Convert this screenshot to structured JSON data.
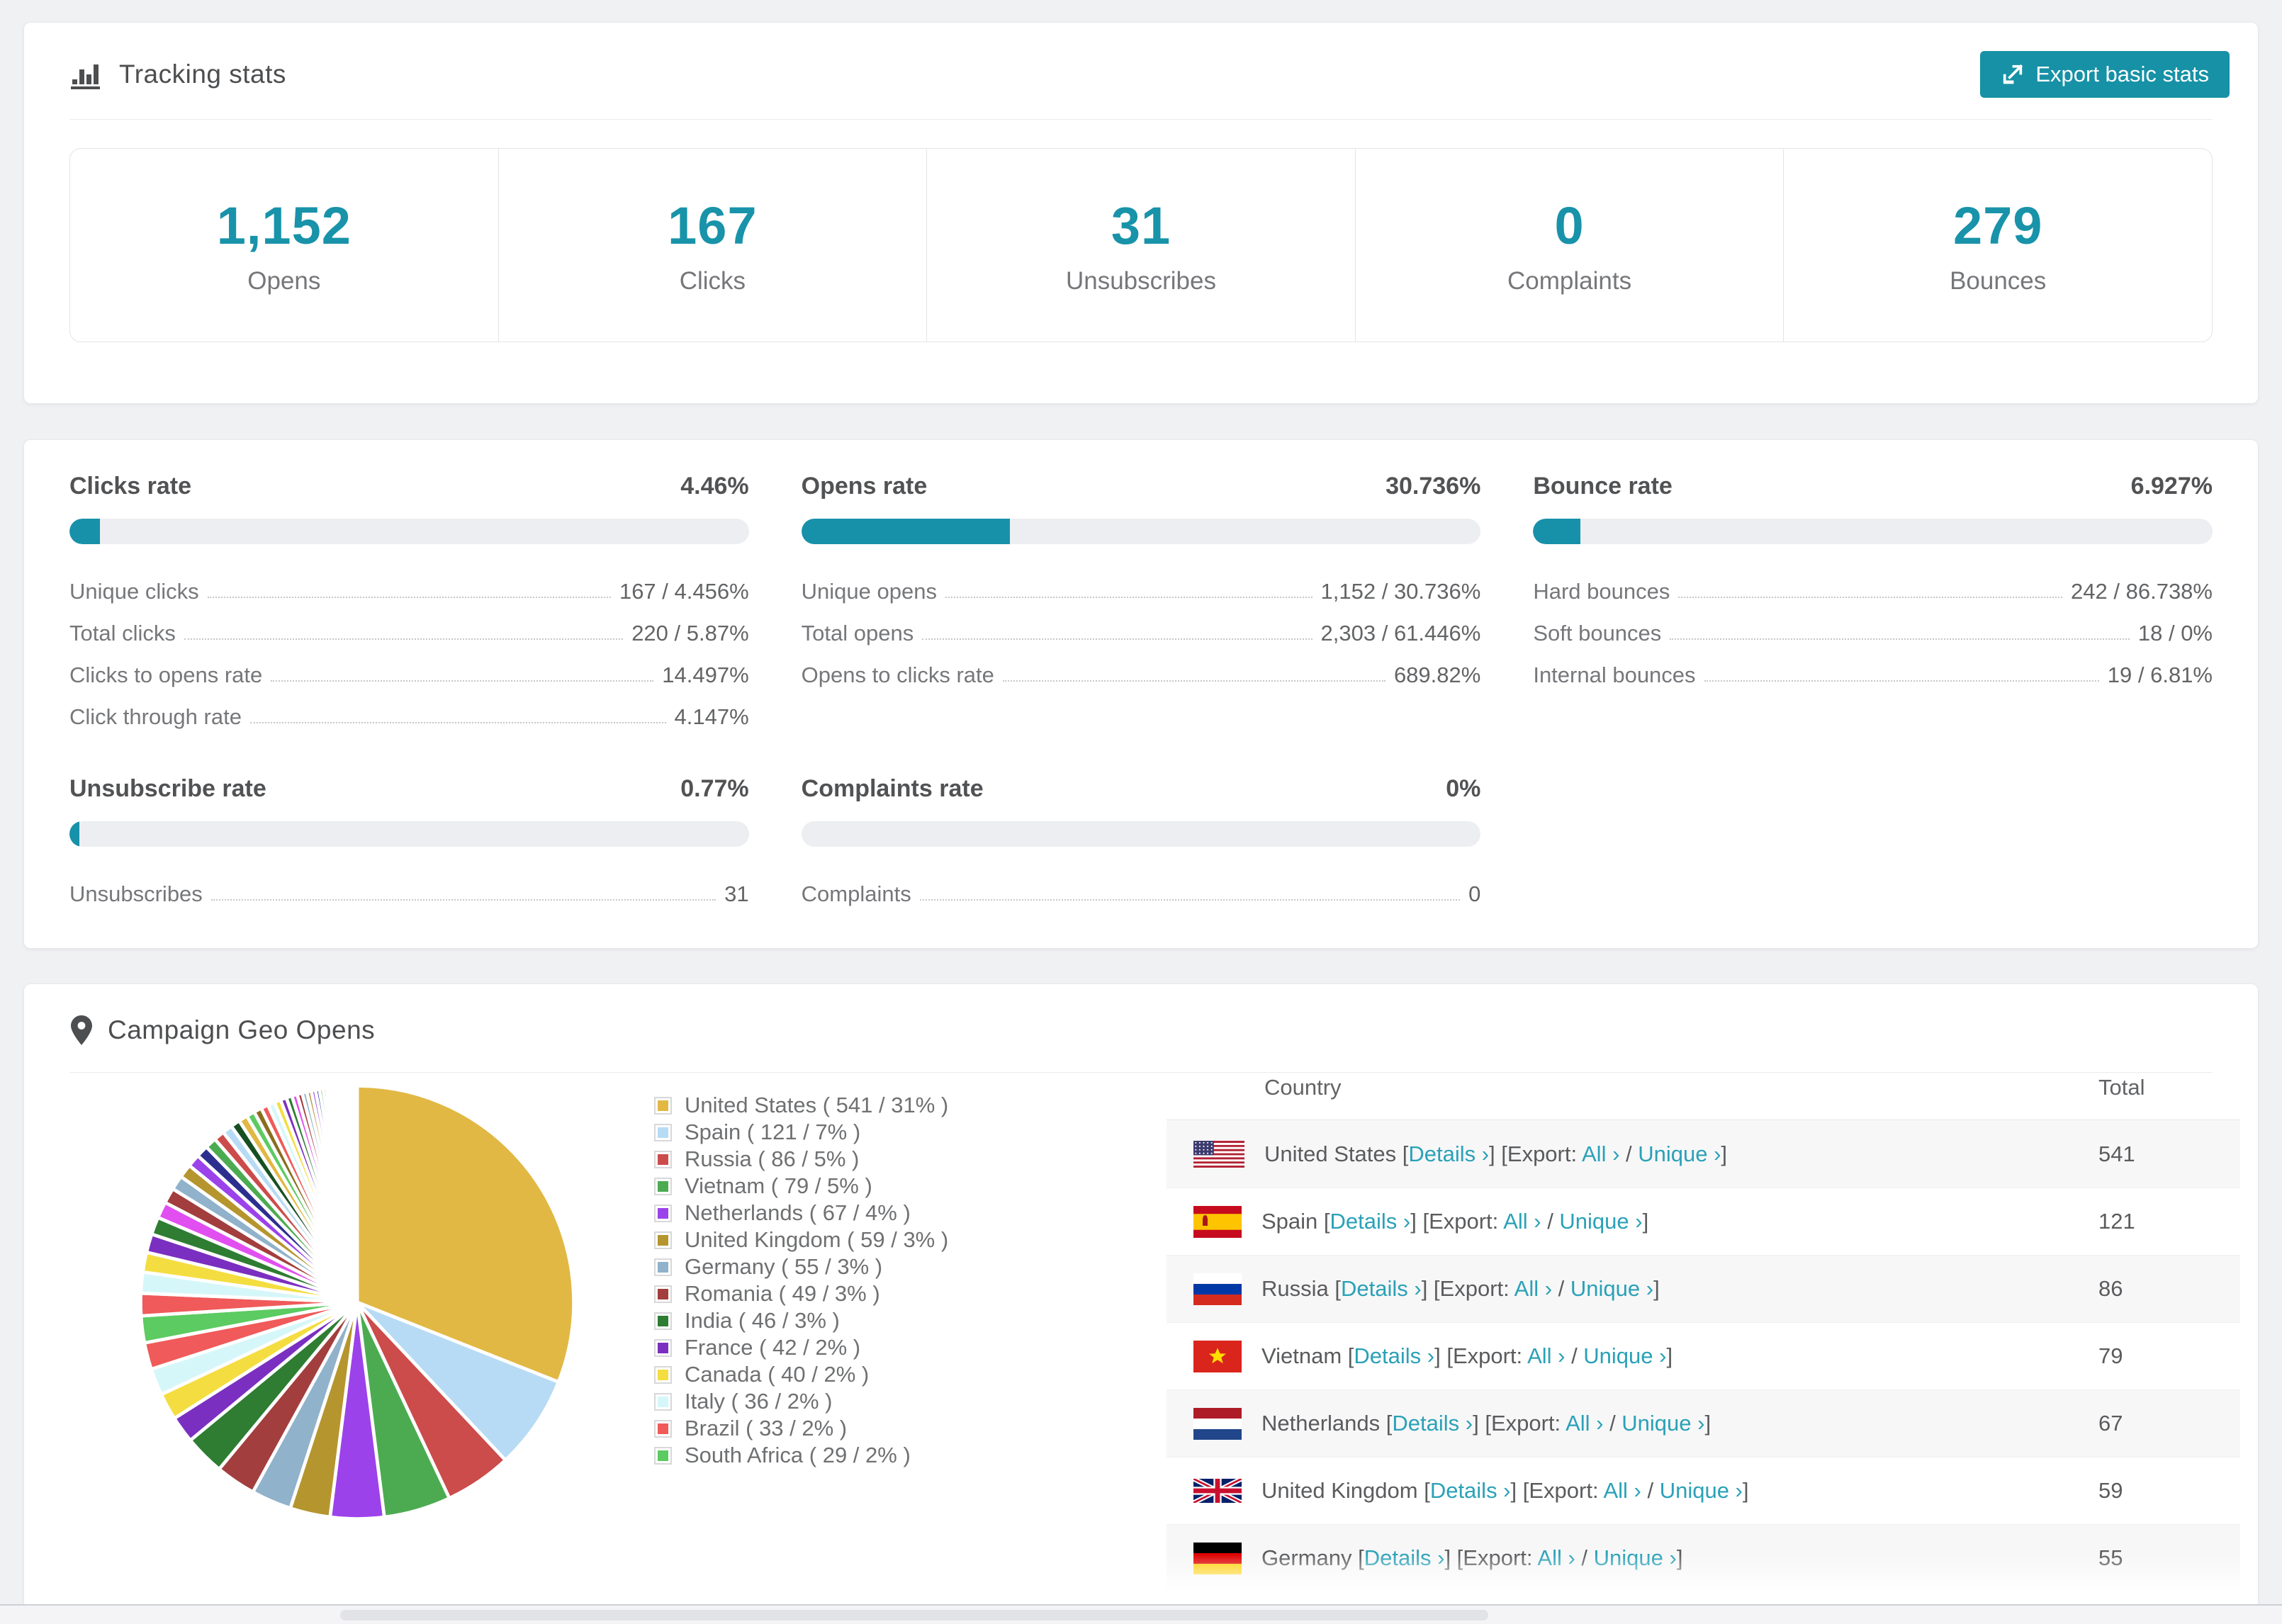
{
  "colors": {
    "accent": "#1791a9",
    "button": "#1791a6",
    "link": "#2aa1b7",
    "track": "#eceef1"
  },
  "header": {
    "title": "Tracking stats",
    "export_label": "Export basic stats"
  },
  "summary": [
    {
      "value": "1,152",
      "label": "Opens"
    },
    {
      "value": "167",
      "label": "Clicks"
    },
    {
      "value": "31",
      "label": "Unsubscribes"
    },
    {
      "value": "0",
      "label": "Complaints"
    },
    {
      "value": "279",
      "label": "Bounces"
    }
  ],
  "rates": {
    "row1": [
      {
        "title": "Clicks rate",
        "value": "4.46%",
        "pct": 4.46,
        "rows": [
          [
            "Unique clicks",
            "167 / 4.456%"
          ],
          [
            "Total clicks",
            "220 / 5.87%"
          ],
          [
            "Clicks to opens rate",
            "14.497%"
          ],
          [
            "Click through rate",
            "4.147%"
          ]
        ]
      },
      {
        "title": "Opens rate",
        "value": "30.736%",
        "pct": 30.736,
        "rows": [
          [
            "Unique opens",
            "1,152 / 30.736%"
          ],
          [
            "Total opens",
            "2,303 / 61.446%"
          ],
          [
            "Opens to clicks rate",
            "689.82%"
          ]
        ]
      },
      {
        "title": "Bounce rate",
        "value": "6.927%",
        "pct": 6.927,
        "rows": [
          [
            "Hard bounces",
            "242 / 86.738%"
          ],
          [
            "Soft bounces",
            "18 / 0%"
          ],
          [
            "Internal bounces",
            "19 / 6.81%"
          ]
        ]
      }
    ],
    "row2": [
      {
        "title": "Unsubscribe rate",
        "value": "0.77%",
        "pct": 0.77,
        "rows": [
          [
            "Unsubscribes",
            "31"
          ]
        ]
      },
      {
        "title": "Complaints rate",
        "value": "0%",
        "pct": 0,
        "rows": [
          [
            "Complaints",
            "0"
          ]
        ]
      }
    ]
  },
  "geo": {
    "title": "Campaign Geo Opens",
    "table": {
      "columns": [
        "Country",
        "Total"
      ],
      "labels": {
        "details": "Details ›",
        "export_prefix": "Export:",
        "all": "All ›",
        "unique": "Unique ›",
        "open_bracket": "[",
        "close_bracket": "]",
        "slash": "/"
      },
      "rows": [
        {
          "country": "United States",
          "flag": "us",
          "total": "541"
        },
        {
          "country": "Spain",
          "flag": "es",
          "total": "121"
        },
        {
          "country": "Russia",
          "flag": "ru",
          "total": "86"
        },
        {
          "country": "Vietnam",
          "flag": "vn",
          "total": "79"
        },
        {
          "country": "Netherlands",
          "flag": "nl",
          "total": "67"
        },
        {
          "country": "United Kingdom",
          "flag": "gb",
          "total": "59"
        },
        {
          "country": "Germany",
          "flag": "de",
          "total": "55"
        }
      ]
    },
    "chart_data": {
      "type": "pie",
      "title": "Campaign Geo Opens",
      "unit": "opens",
      "start_angle": "top",
      "direction": "clockwise",
      "legend_position": "right",
      "series": [
        {
          "name": "United States",
          "value": 541,
          "pct": 31,
          "color": "#e2b844"
        },
        {
          "name": "Spain",
          "value": 121,
          "pct": 7,
          "color": "#b7dbf4"
        },
        {
          "name": "Russia",
          "value": 86,
          "pct": 5,
          "color": "#cc4b4b"
        },
        {
          "name": "Vietnam",
          "value": 79,
          "pct": 5,
          "color": "#4cab51"
        },
        {
          "name": "Netherlands",
          "value": 67,
          "pct": 4,
          "color": "#9c42ea"
        },
        {
          "name": "United Kingdom",
          "value": 59,
          "pct": 3,
          "color": "#b5952e"
        },
        {
          "name": "Germany",
          "value": 55,
          "pct": 3,
          "color": "#90b2ca"
        },
        {
          "name": "Romania",
          "value": 49,
          "pct": 3,
          "color": "#a33e3e"
        },
        {
          "name": "India",
          "value": 46,
          "pct": 3,
          "color": "#2e7d32"
        },
        {
          "name": "France",
          "value": 42,
          "pct": 2,
          "color": "#7b2fc0"
        },
        {
          "name": "Canada",
          "value": 40,
          "pct": 2,
          "color": "#f4dd40"
        },
        {
          "name": "Italy",
          "value": 36,
          "pct": 2,
          "color": "#d6f7f9"
        },
        {
          "name": "Brazil",
          "value": 33,
          "pct": 2,
          "color": "#f05a5a"
        },
        {
          "name": "South Africa",
          "value": 29,
          "pct": 2,
          "color": "#5ccb61"
        }
      ],
      "others": {
        "slice_count": 44,
        "total_pct": 26,
        "decay": 0.94,
        "palette": [
          "#f05a5a",
          "#d6f7f9",
          "#f4dd40",
          "#7b2fc0",
          "#2e7d32",
          "#e14ff0",
          "#a33e3e",
          "#90b2ca",
          "#b5952e",
          "#9c42ea",
          "#2d2f8e",
          "#4cab51",
          "#cc4b4b",
          "#b7dbf4",
          "#174f23",
          "#e2b844",
          "#5ccb61",
          "#8a6d1f"
        ]
      }
    }
  },
  "scrollbar": {
    "present": true
  }
}
